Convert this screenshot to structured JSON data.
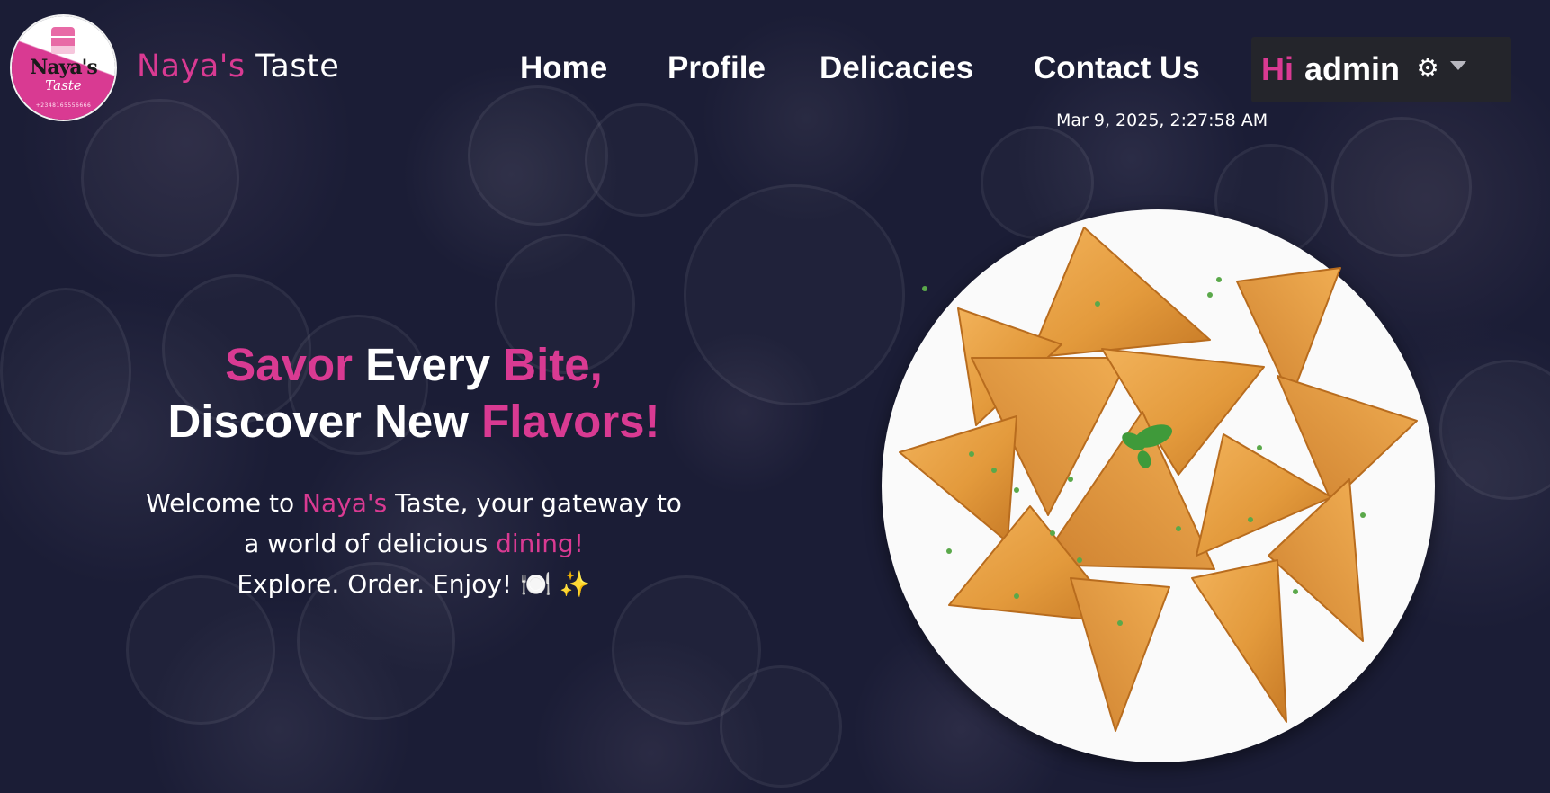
{
  "brand": {
    "logo": {
      "main": "Naya's",
      "sub": "Taste",
      "phone": "+2348165556666"
    },
    "name_part1": "Naya's",
    "name_part2": "Taste"
  },
  "nav": {
    "items": [
      {
        "label": "Home"
      },
      {
        "label": "Profile"
      },
      {
        "label": "Delicacies"
      },
      {
        "label": "Contact Us"
      }
    ]
  },
  "user": {
    "greeting": "Hi",
    "name": "admin",
    "settings_icon": "gear-icon",
    "dropdown_icon": "caret-down-icon"
  },
  "clock": "Mar 9, 2025, 2:27:58 AM",
  "hero": {
    "title": {
      "line1": [
        "Savor",
        " Every ",
        "Bite,"
      ],
      "line2": [
        "Discover New ",
        "Flavors!"
      ]
    },
    "text": {
      "line1": [
        "Welcome to ",
        "Naya's",
        " Taste, your gateway to"
      ],
      "line2": [
        "a world of delicious ",
        "dining!"
      ],
      "line3": "Explore. Order. Enjoy! 🍽️ ✨"
    },
    "image_alt": "plate of samosas"
  },
  "colors": {
    "accent": "#d93a92",
    "background": "#1b1d36",
    "text": "#ffffff",
    "user_box": "#24252b"
  }
}
